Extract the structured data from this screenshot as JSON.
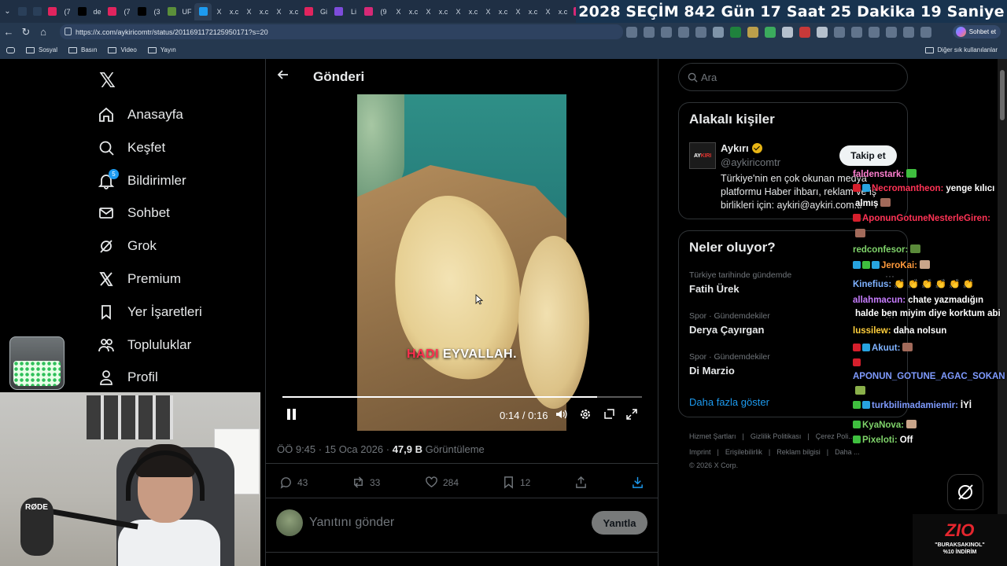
{
  "browser": {
    "tabs": [
      {
        "text": "",
        "color": "#2a3f59"
      },
      {
        "text": "",
        "color": "#2a3f59"
      },
      {
        "text": "",
        "color": "#e0245e"
      },
      {
        "text": "(7",
        "color": "#e0245e"
      },
      {
        "text": "",
        "color": "#000000"
      },
      {
        "text": "de",
        "color": "#000000"
      },
      {
        "text": "",
        "color": "#e0245e"
      },
      {
        "text": "(7",
        "color": "#e0245e"
      },
      {
        "text": "",
        "color": "#000000"
      },
      {
        "text": "(3",
        "color": "#000000"
      },
      {
        "text": "",
        "color": "#5b8f3a"
      },
      {
        "text": "UF",
        "color": "#5b8f3a"
      },
      {
        "text": "",
        "color": "#1d9bf0"
      },
      {
        "text": "X",
        "color": "#000000"
      },
      {
        "text": "x.c",
        "color": "#000000"
      },
      {
        "text": "X",
        "color": "#000000"
      },
      {
        "text": "x.c",
        "color": "#000000"
      },
      {
        "text": "X",
        "color": "#000000"
      },
      {
        "text": "x.c",
        "color": "#000000"
      },
      {
        "text": "",
        "color": "#e0245e"
      },
      {
        "text": "Gi",
        "color": "#e0245e"
      },
      {
        "text": "",
        "color": "#7d4cdb"
      },
      {
        "text": "Li",
        "color": "#7d4cdb"
      },
      {
        "text": "",
        "color": "#d62976"
      },
      {
        "text": "(9",
        "color": "#d62976"
      },
      {
        "text": "X",
        "color": "#000000"
      },
      {
        "text": "x.c",
        "color": "#000000"
      },
      {
        "text": "X",
        "color": "#000000"
      },
      {
        "text": "x.c",
        "color": "#000000"
      },
      {
        "text": "X",
        "color": "#000000"
      },
      {
        "text": "x.c",
        "color": "#000000"
      },
      {
        "text": "X",
        "color": "#000000"
      },
      {
        "text": "x.c",
        "color": "#000000"
      },
      {
        "text": "X",
        "color": "#000000"
      },
      {
        "text": "x.c",
        "color": "#000000"
      },
      {
        "text": "X",
        "color": "#000000"
      },
      {
        "text": "x.c",
        "color": "#000000"
      },
      {
        "text": "",
        "color": "#d62976"
      }
    ],
    "countdown": [
      "2028",
      "SEÇİM",
      "842 Gün",
      "17 Saat",
      "25 Dakika",
      "19 Saniye"
    ],
    "url": "https://x.com/aykiricomtr/status/2011691172125950171?s=20",
    "sohbet_label": "Sohbet et",
    "bookmarks": [
      "Sosyal",
      "Basın",
      "Video",
      "Yayın"
    ],
    "bookmarks_right": "Diğer sık kullanılanlar",
    "addr_icon_colors": [
      "#6c7f96",
      "#6c7f96",
      "#6c7f96",
      "#6c7f96",
      "#6c7f96",
      "#8fa4b8",
      "#1f8f3a",
      "#d6b14a",
      "#3fbf5f",
      "#cfd8e3",
      "#e53935",
      "#cfd8e3",
      "#6c7f96",
      "#6c7f96",
      "#6c7f96",
      "#6c7f96",
      "#6c7f96",
      "#6c7f96"
    ]
  },
  "nav": {
    "items": [
      {
        "label": "Anasayfa",
        "icon": "home-icon"
      },
      {
        "label": "Keşfet",
        "icon": "search-icon"
      },
      {
        "label": "Bildirimler",
        "icon": "bell-icon",
        "badge": "5"
      },
      {
        "label": "Sohbet",
        "icon": "mail-icon"
      },
      {
        "label": "Grok",
        "icon": "grok-icon"
      },
      {
        "label": "Premium",
        "icon": "x-icon"
      },
      {
        "label": "Yer İşaretleri",
        "icon": "bookmark-icon"
      },
      {
        "label": "Topluluklar",
        "icon": "people-icon"
      },
      {
        "label": "Profil",
        "icon": "person-icon"
      }
    ]
  },
  "post": {
    "header": "Gönderi",
    "caption_red": "HADI",
    "caption_white": "EYVALLAH.",
    "time": "0:14 / 0:16",
    "progress": 0.875,
    "meta_time": "ÖÖ 9:45 · 15 Oca 2026 ·",
    "views": "47,9 B",
    "views_label": "Görüntüleme",
    "replies": "43",
    "reposts": "33",
    "likes": "284",
    "bookmarks": "12",
    "reply_placeholder": "Yanıtını gönder",
    "reply_button": "Yanıtla"
  },
  "right": {
    "search_placeholder": "Ara",
    "related_title": "Alakalı kişiler",
    "person": {
      "name": "Aykırı",
      "handle": "@aykiricomtr",
      "bio": "Türkiye'nin en çok okunan medya platformu Haber ihbarı, reklam ve iş birlikleri için: aykiri@aykiri.com.tr",
      "follow": "Takip et",
      "avatar_left": "AY",
      "avatar_right": "KIRI"
    },
    "trends_title": "Neler oluyor?",
    "trends": [
      {
        "cat": "Türkiye tarihinde gündemde",
        "name": "Fatih Ürek"
      },
      {
        "cat": "Spor · Gündemdekiler",
        "name": "Derya Çayırgan"
      },
      {
        "cat": "Spor · Gündemdekiler",
        "name": "Di Marzio"
      }
    ],
    "more": "Daha fazla göster",
    "footer1": [
      "Hizmet Şartları",
      "|",
      "Gizlilik Politikası",
      "|",
      "Çerez Poli..."
    ],
    "footer2": [
      "Imprint",
      "|",
      "Erişilebilirlik",
      "|",
      "Reklam bilgisi",
      "|",
      "Daha ..."
    ],
    "copyright": "© 2026 X Corp."
  },
  "chat": [
    {
      "user": "faldenstark:",
      "color": "#ff7fd0",
      "msg": "",
      "emote": "#3fbf3f",
      "badges": []
    },
    {
      "user": "Necromantheon:",
      "color": "#ff3355",
      "msg": "yenge kılıcı",
      "emote": "",
      "badges": [
        "#d61f2c",
        "#27a4e0"
      ]
    },
    {
      "user": "",
      "color": "#ffffff",
      "msg": "almış",
      "emote": "#a26a5a",
      "badges": []
    },
    {
      "user": "AponunGotuneNesterleGiren:",
      "color": "#ff3355",
      "msg": "",
      "emote": "",
      "badges": [
        "#d61f2c"
      ]
    },
    {
      "user": "",
      "color": "#ffffff",
      "msg": "",
      "emote": "#a26a5a",
      "badges": []
    },
    {
      "user": "redconfesor:",
      "color": "#7fd36a",
      "msg": "",
      "emote": "#5a8a3a",
      "badges": []
    },
    {
      "user": "JeroKai:",
      "color": "#ff9a3c",
      "msg": "",
      "emote": "#c9a58a",
      "badges": [
        "#27a4e0",
        "#3fbf3f",
        "#27a4e0"
      ]
    },
    {
      "user": "Kinefius:",
      "color": "#7fb2ff",
      "msg": "👏 👏 👏 👏 👏 👏",
      "emote": "",
      "badges": []
    },
    {
      "user": "allahmacun:",
      "color": "#c77dff",
      "msg": "chate yazmadığın",
      "emote": "",
      "badges": []
    },
    {
      "user": "",
      "color": "#ffffff",
      "msg": "halde ben miyim diye korktum abi",
      "emote": "",
      "badges": []
    },
    {
      "user": "lussilew:",
      "color": "#ffcf3c",
      "msg": "daha nolsun",
      "emote": "",
      "badges": []
    },
    {
      "user": "Akuut:",
      "color": "#7fb2ff",
      "msg": "",
      "emote": "#a26a5a",
      "badges": [
        "#d61f2c",
        "#27a4e0"
      ]
    },
    {
      "user": "",
      "color": "#ffffff",
      "msg": "",
      "emote": "",
      "badges": [
        "#d61f2c"
      ]
    },
    {
      "user": "APONUN_GOTUNE_AGAC_SOKAN",
      "color": "#7f9bff",
      "msg": "",
      "emote": "",
      "badges": []
    },
    {
      "user": "",
      "color": "#ffffff",
      "msg": "",
      "emote": "#8ab04a",
      "badges": []
    },
    {
      "user": "turkbilimadamiemir:",
      "color": "#7f9bff",
      "msg": "İYİ",
      "emote": "",
      "badges": [
        "#3fbf3f",
        "#27a4e0"
      ]
    },
    {
      "user": "KyaNova:",
      "color": "#7fd36a",
      "msg": "",
      "emote": "#c9a58a",
      "badges": [
        "#3fbf3f"
      ]
    },
    {
      "user": "Pixeloti:",
      "color": "#7fd36a",
      "msg": "Off",
      "emote": "",
      "badges": [
        "#3fbf3f"
      ]
    }
  ],
  "stream": {
    "mic_brand": "RØDE",
    "promo_logo_main": "Z",
    "promo_logo_accent": "IO",
    "promo_code": "\"BURAKSAKINOL\"",
    "promo_discount": "%10 İNDİRİM"
  }
}
